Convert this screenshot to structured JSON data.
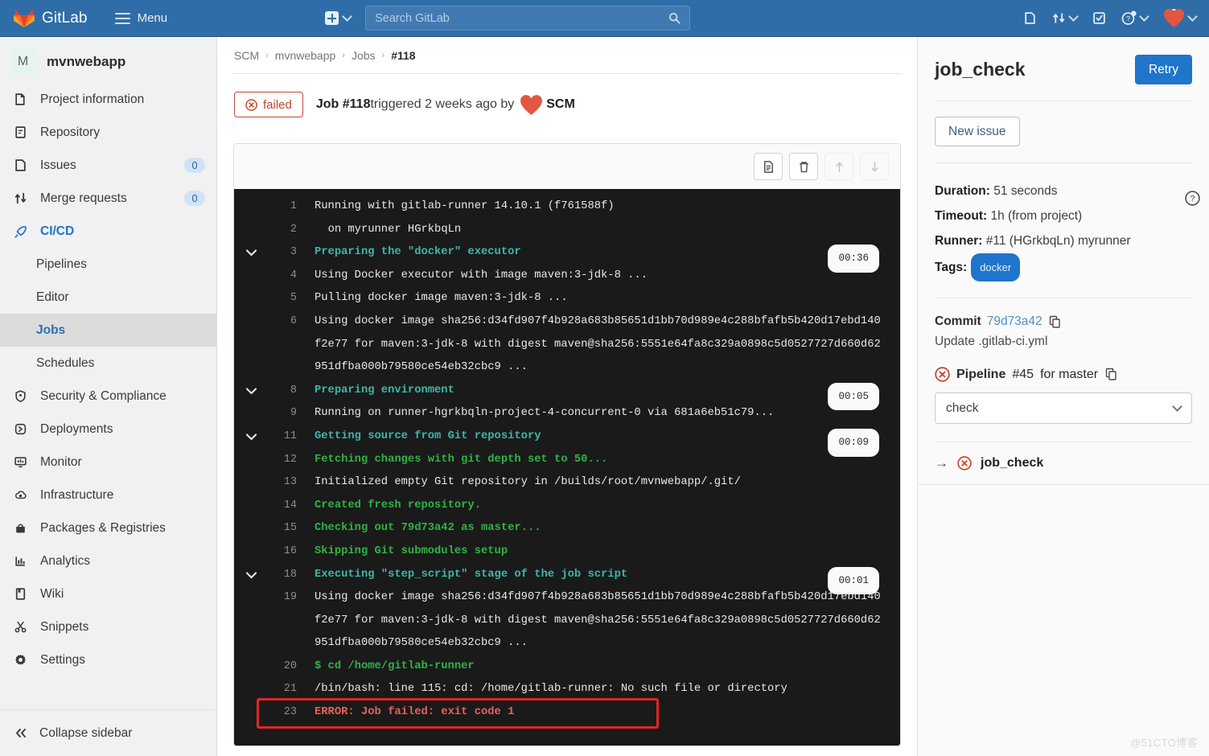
{
  "topnav": {
    "brand": "GitLab",
    "menu_label": "Menu",
    "search_placeholder": "Search GitLab",
    "search_value": "",
    "icons": [
      "plus-icon",
      "chevron-down-icon",
      "search-icon",
      "issues-icon",
      "merge-request-icon",
      "todo-checkbox-icon",
      "help-icon",
      "user-avatar-icon"
    ]
  },
  "sidebar": {
    "project_initial": "M",
    "project_name": "mvnwebapp",
    "items": [
      {
        "label": "Project information",
        "icon": "project-info-icon",
        "badge": ""
      },
      {
        "label": "Repository",
        "icon": "repository-icon",
        "badge": ""
      },
      {
        "label": "Issues",
        "icon": "issues-icon",
        "badge": "0"
      },
      {
        "label": "Merge requests",
        "icon": "merge-request-icon",
        "badge": "0"
      },
      {
        "label": "CI/CD",
        "icon": "rocket-icon",
        "badge": ""
      }
    ],
    "subitems": [
      {
        "label": "Pipelines",
        "active": false
      },
      {
        "label": "Editor",
        "active": false
      },
      {
        "label": "Jobs",
        "active": true
      },
      {
        "label": "Schedules",
        "active": false
      }
    ],
    "items_lower": [
      {
        "label": "Security & Compliance",
        "icon": "shield-icon"
      },
      {
        "label": "Deployments",
        "icon": "deployments-icon"
      },
      {
        "label": "Monitor",
        "icon": "monitor-icon"
      },
      {
        "label": "Infrastructure",
        "icon": "infrastructure-icon"
      },
      {
        "label": "Packages & Registries",
        "icon": "package-icon"
      },
      {
        "label": "Analytics",
        "icon": "analytics-icon"
      },
      {
        "label": "Wiki",
        "icon": "book-icon"
      },
      {
        "label": "Snippets",
        "icon": "scissors-icon"
      },
      {
        "label": "Settings",
        "icon": "gear-icon"
      }
    ],
    "collapse_label": "Collapse sidebar"
  },
  "breadcrumb": {
    "items": [
      "SCM",
      "mvnwebapp",
      "Jobs"
    ],
    "current": "#118",
    "separator": "›"
  },
  "job_header": {
    "status": "failed",
    "status_icon": "failed-x-circle-icon",
    "job_label": "Job #118",
    "triggered_text": " triggered 2 weeks ago by ",
    "author": "SCM",
    "author_avatar": "heart-avatar-icon"
  },
  "log_toolbar": {
    "buttons": [
      {
        "name": "show-raw-button",
        "icon": "document-icon",
        "disabled": false
      },
      {
        "name": "erase-log-button",
        "icon": "trash-icon",
        "disabled": false
      },
      {
        "name": "scroll-top-button",
        "icon": "arrow-up-icon",
        "disabled": true
      },
      {
        "name": "scroll-bottom-button",
        "icon": "arrow-down-icon",
        "disabled": true
      }
    ]
  },
  "log": {
    "lines": [
      {
        "num": "1",
        "text": "Running with gitlab-runner 14.10.1 (f761588f)",
        "color": "white",
        "arrow": false,
        "duration": ""
      },
      {
        "num": "2",
        "text": "  on myrunner HGrkbqLn",
        "color": "white",
        "arrow": false,
        "duration": ""
      },
      {
        "num": "3",
        "text": "Preparing the \"docker\" executor",
        "color": "teal",
        "arrow": true,
        "duration": "00:36"
      },
      {
        "num": "4",
        "text": "Using Docker executor with image maven:3-jdk-8 ...",
        "color": "white",
        "arrow": false,
        "duration": ""
      },
      {
        "num": "5",
        "text": "Pulling docker image maven:3-jdk-8 ...",
        "color": "white",
        "arrow": false,
        "duration": ""
      },
      {
        "num": "6",
        "text": "Using docker image sha256:d34fd907f4b928a683b85651d1bb70d989e4c288bfafb5b420d17ebd140f2e77 for maven:3-jdk-8 with digest maven@sha256:5551e64fa8c329a0898c5d0527727d660d62951dfba000b79580ce54eb32cbc9 ...",
        "color": "white",
        "arrow": false,
        "duration": ""
      },
      {
        "num": "8",
        "text": "Preparing environment",
        "color": "teal",
        "arrow": true,
        "duration": "00:05"
      },
      {
        "num": "9",
        "text": "Running on runner-hgrkbqln-project-4-concurrent-0 via 681a6eb51c79...",
        "color": "white",
        "arrow": false,
        "duration": ""
      },
      {
        "num": "11",
        "text": "Getting source from Git repository",
        "color": "teal",
        "arrow": true,
        "duration": "00:09"
      },
      {
        "num": "12",
        "text": "Fetching changes with git depth set to 50...",
        "color": "green",
        "arrow": false,
        "duration": ""
      },
      {
        "num": "13",
        "text": "Initialized empty Git repository in /builds/root/mvnwebapp/.git/",
        "color": "white",
        "arrow": false,
        "duration": ""
      },
      {
        "num": "14",
        "text": "Created fresh repository.",
        "color": "green",
        "arrow": false,
        "duration": ""
      },
      {
        "num": "15",
        "text": "Checking out 79d73a42 as master...",
        "color": "green",
        "arrow": false,
        "duration": ""
      },
      {
        "num": "16",
        "text": "Skipping Git submodules setup",
        "color": "green",
        "arrow": false,
        "duration": ""
      },
      {
        "num": "18",
        "text": "Executing \"step_script\" stage of the job script",
        "color": "teal",
        "arrow": true,
        "duration": "00:01"
      },
      {
        "num": "19",
        "text": "Using docker image sha256:d34fd907f4b928a683b85651d1bb70d989e4c288bfafb5b420d17ebd140f2e77 for maven:3-jdk-8 with digest maven@sha256:5551e64fa8c329a0898c5d0527727d660d62951dfba000b79580ce54eb32cbc9 ...",
        "color": "white",
        "arrow": false,
        "duration": ""
      },
      {
        "num": "20",
        "text": "$ cd /home/gitlab-runner",
        "color": "green",
        "arrow": false,
        "duration": ""
      },
      {
        "num": "21",
        "text": "/bin/bash: line 115: cd: /home/gitlab-runner: No such file or directory",
        "color": "white",
        "arrow": false,
        "duration": ""
      },
      {
        "num": "23",
        "text": "ERROR: Job failed: exit code 1",
        "color": "red",
        "arrow": false,
        "duration": ""
      }
    ]
  },
  "right_panel": {
    "title": "job_check",
    "retry_label": "Retry",
    "new_issue_label": "New issue",
    "duration_label": "Duration:",
    "duration_value": " 51 seconds",
    "timeout_label": "Timeout:",
    "timeout_value": " 1h (from project)",
    "runner_label": "Runner:",
    "runner_value": " #11 (HGrkbqLn) myrunner",
    "tags_label": "Tags:",
    "tag_value": "docker",
    "commit_label": "Commit",
    "commit_sha": "79d73a42",
    "commit_message": "Update .gitlab-ci.yml",
    "pipeline_label": "Pipeline",
    "pipeline_id": "#45",
    "pipeline_for": "for master",
    "stage_selected": "check",
    "job_link_name": "job_check"
  },
  "watermark": "@51CTO博客",
  "colors": {
    "nav_blue": "#2f6da8",
    "accent_blue": "#1f75cb",
    "fail_red": "#b8452d",
    "log_bg": "#1a1a1a",
    "log_teal": "#3fb6a8",
    "log_green": "#2fb344",
    "log_red": "#e8615a",
    "annotation_red": "#e02626"
  }
}
